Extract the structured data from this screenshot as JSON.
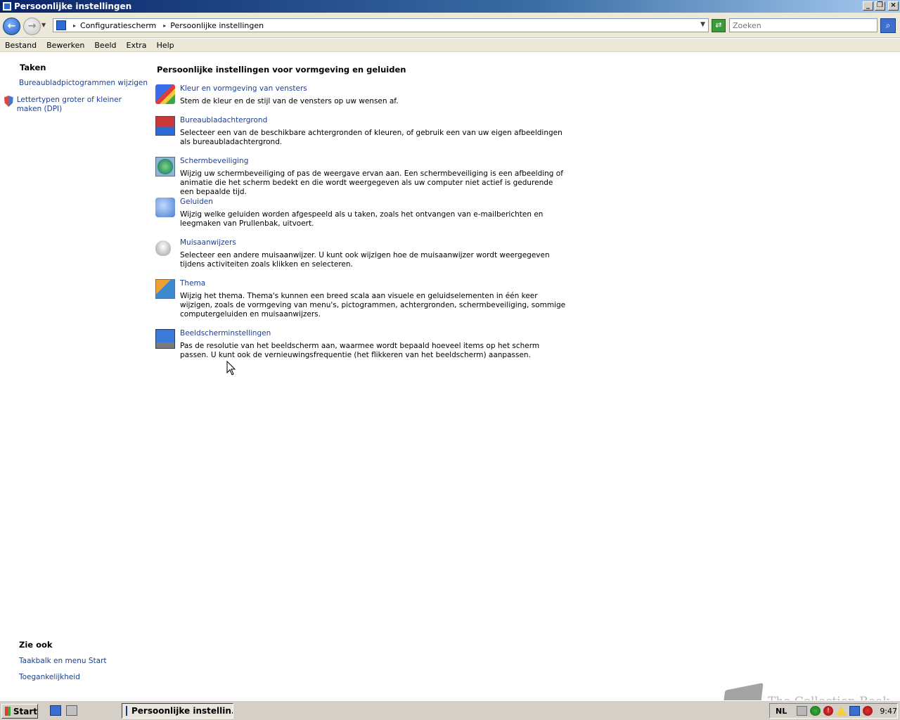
{
  "window": {
    "title": "Persoonlijke instellingen",
    "controls": [
      "minimize",
      "restore",
      "close"
    ]
  },
  "address_bar": {
    "crumbs": [
      "Configuratiescherm",
      "Persoonlijke instellingen"
    ],
    "search_placeholder": "Zoeken"
  },
  "menu": [
    "Bestand",
    "Bewerken",
    "Beeld",
    "Extra",
    "Help"
  ],
  "sidebar": {
    "tasks_heading": "Taken",
    "tasks": [
      {
        "label": "Bureaubladpictogrammen wijzigen",
        "icon": ""
      },
      {
        "label": "Lettertypen groter of kleiner maken (DPI)",
        "icon": "shield-icon"
      }
    ],
    "see_also_heading": "Zie ook",
    "see_also": [
      "Taakbalk en menu Start",
      "Toegankelijkheid"
    ]
  },
  "main": {
    "heading": "Persoonlijke instellingen voor vormgeving en geluiden",
    "items": [
      {
        "title": "Kleur en vormgeving van vensters",
        "desc": "Stem de kleur en de stijl van de vensters op uw wensen af.",
        "icon": "color-appearance-icon"
      },
      {
        "title": "Bureaubladachtergrond",
        "desc": "Selecteer een van de beschikbare achtergronden of kleuren, of gebruik een van uw eigen afbeeldingen als bureaubladachtergrond.",
        "icon": "desktop-background-icon"
      },
      {
        "title": "Schermbeveiliging",
        "desc": "Wijzig uw schermbeveiliging of pas de weergave ervan aan. Een schermbeveiliging is een afbeelding of animatie die het scherm bedekt en die wordt weergegeven als uw computer niet actief is gedurende een bepaalde tijd.",
        "icon": "screensaver-icon"
      },
      {
        "title": "Geluiden",
        "desc": "Wijzig welke geluiden worden afgespeeld als u taken, zoals het ontvangen van e-mailberichten en leegmaken van Prullenbak, uitvoert.",
        "icon": "sounds-icon"
      },
      {
        "title": "Muisaanwijzers",
        "desc": "Selecteer een andere muisaanwijzer. U kunt ook wijzigen hoe de muisaanwijzer wordt weergegeven tijdens activiteiten zoals klikken en selecteren.",
        "icon": "mouse-pointers-icon"
      },
      {
        "title": "Thema",
        "desc": "Wijzig het thema. Thema's kunnen een breed scala aan visuele en geluidselementen in één keer wijzigen, zoals de vormgeving van menu's, pictogrammen, achtergronden, schermbeveiliging, sommige computergeluiden en muisaanwijzers.",
        "icon": "theme-icon"
      },
      {
        "title": "Beeldscherminstellingen",
        "desc": "Pas de resolutie van het beeldscherm aan, waarmee wordt bepaald hoeveel items op het scherm passen. U kunt ook de vernieuwingsfrequentie (het flikkeren van het beeldscherm) aanpassen.",
        "icon": "display-settings-icon"
      }
    ]
  },
  "taskbar": {
    "start_label": "Start",
    "task_button": "Persoonlijke instellin...",
    "language": "NL",
    "clock": "9:47"
  },
  "watermark": "The Collection Book"
}
